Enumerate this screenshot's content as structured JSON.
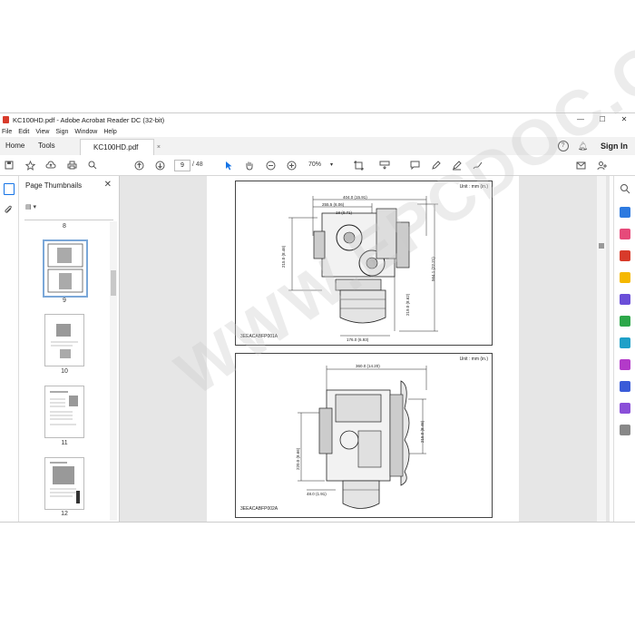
{
  "window": {
    "title": "KC100HD.pdf - Adobe Acrobat Reader DC (32-bit)",
    "controls": [
      "—",
      "☐",
      "✕"
    ]
  },
  "menu": [
    "File",
    "Edit",
    "View",
    "Sign",
    "Window",
    "Help"
  ],
  "tabs": {
    "home": "Home",
    "tools": "Tools",
    "document": "KC100HD.pdf",
    "sign_in": "Sign In"
  },
  "toolbar": {
    "current_page": "9",
    "page_of": "/  48",
    "zoom": "70%"
  },
  "panel": {
    "title": "Page Thumbnails",
    "close": "✕",
    "options": "▤ ▾",
    "thumbnails": [
      {
        "label": "8"
      },
      {
        "label": "9"
      },
      {
        "label": "10"
      },
      {
        "label": "11"
      },
      {
        "label": "12"
      }
    ]
  },
  "document": {
    "diagram1": {
      "unit": "Unit : mm (in.)",
      "code": "3EEACABFP001A",
      "dims": {
        "top_width": "404.0 (15.91)",
        "mid_width": "255.5 (6.06)",
        "small": "18 (0.71)",
        "left_height": "215.0 (8.46)",
        "right_height": "564.1 (22.21)",
        "lower_height": "219.0 (8.62)",
        "bottom_width": "176.0 (6.93)"
      }
    },
    "diagram2": {
      "unit": "Unit : mm (in.)",
      "code": "3EEACABFP002A",
      "dims": {
        "top_width": "360.0 (14.20)",
        "right_height": "215.0 (8.46)",
        "left_height": "220.0 (8.66)",
        "bottom_width": "48.0 (1.91)"
      }
    }
  },
  "watermark": "WWW.EPCDOC.COM",
  "colors": {
    "acrobat_red": "#d83b2b",
    "accent_blue": "#1473e6",
    "selection_border": "#7aa7d8"
  }
}
